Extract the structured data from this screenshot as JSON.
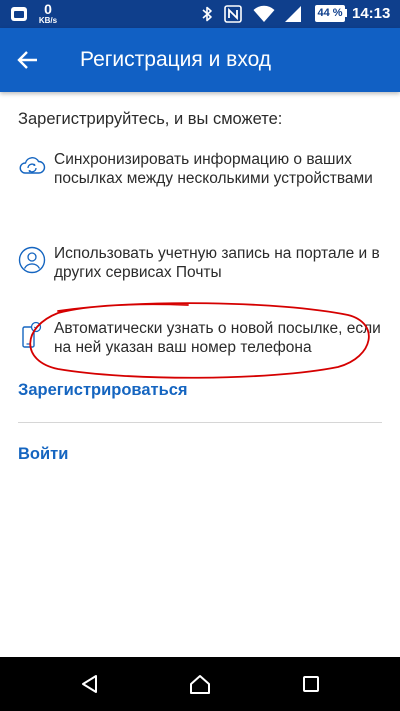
{
  "status_bar": {
    "speed_value": "0",
    "speed_unit": "KB/s",
    "battery": "44 %",
    "time": "14:13",
    "icons": [
      "app-notification-icon",
      "bluetooth-icon",
      "nfc-icon",
      "wifi-icon",
      "cell-signal-icon",
      "battery-icon"
    ]
  },
  "app_bar": {
    "title": "Регистрация и вход",
    "back_icon": "arrow-left-icon"
  },
  "content": {
    "intro": "Зарегистрируйтесь, и вы сможете:",
    "features": [
      {
        "icon": "cloud-sync-icon",
        "text": "Синхронизировать информацию о ваших посылках между несколькими устройствами"
      },
      {
        "icon": "user-account-icon",
        "text": "Использовать учетную запись на портале и в других сервисах Почты"
      },
      {
        "icon": "phone-notification-icon",
        "text": "Автоматически узнать о новой посылке, если на ней указан ваш номер телефона"
      }
    ],
    "register_link": "Зарегистрироваться",
    "login_link": "Войти"
  },
  "nav_bar": {
    "icons": [
      "nav-back-icon",
      "nav-home-icon",
      "nav-recents-icon"
    ]
  },
  "colors": {
    "status_bar": "#0f3f8c",
    "app_bar": "#1160c4",
    "link": "#1565c0",
    "icon_outline": "#1565c0",
    "annotation": "#d50000"
  }
}
